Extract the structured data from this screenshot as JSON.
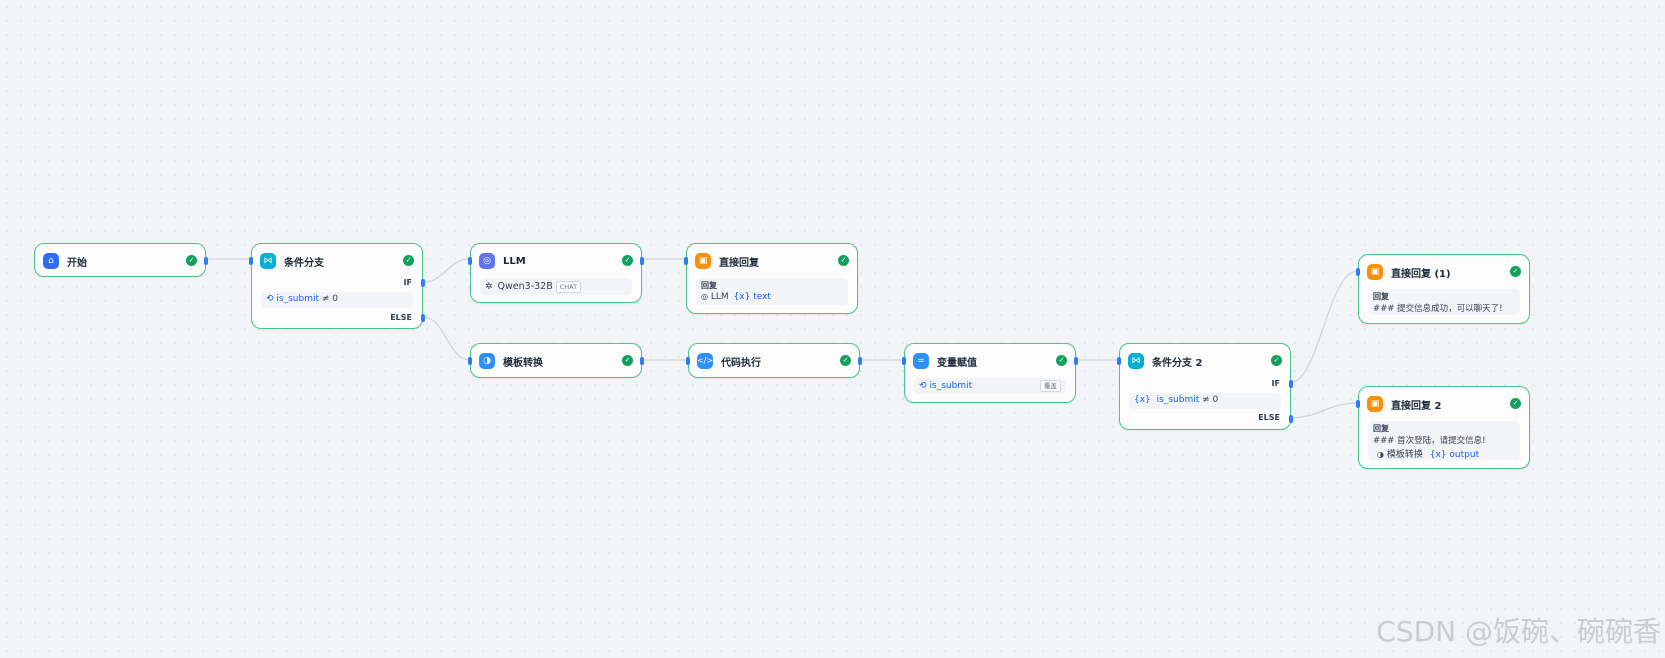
{
  "colors": {
    "border": "#47c78a",
    "handle": "#2e7cf6",
    "status": "#12a05c",
    "edge": "#d0d5dd"
  },
  "nodes": {
    "start": {
      "title": "开始",
      "icon": "home-icon",
      "color": "#2e6cf6"
    },
    "if1": {
      "title": "条件分支",
      "icon": "branch-icon",
      "color": "#06aed4",
      "condition_var": "is_submit",
      "operator": "≠ 0",
      "if_label": "IF",
      "else_label": "ELSE"
    },
    "llm": {
      "title": "LLM",
      "icon": "llm-icon",
      "color": "#6172f3",
      "model": "Qwen3-32B",
      "mode_tag": "CHAT"
    },
    "answer1": {
      "title": "直接回复",
      "icon": "answer-icon",
      "color": "#f79009",
      "reply_label": "回复",
      "source_node": "LLM",
      "source_var": "text"
    },
    "template": {
      "title": "模板转换",
      "icon": "template-icon",
      "color": "#2e90fa"
    },
    "code": {
      "title": "代码执行",
      "icon": "code-icon",
      "color": "#2e90fa"
    },
    "assign": {
      "title": "变量赋值",
      "icon": "assign-icon",
      "color": "#2e90fa",
      "var": "is_submit",
      "op_tag": "覆盖"
    },
    "if2": {
      "title": "条件分支 2",
      "icon": "branch-icon",
      "color": "#06aed4",
      "condition_var": "is_submit",
      "operator": "≠ 0",
      "if_label": "IF",
      "else_label": "ELSE"
    },
    "answer_a": {
      "title": "直接回复 (1)",
      "icon": "answer-icon",
      "color": "#f79009",
      "reply_label": "回复",
      "text": "### 提交信息成功，可以聊天了!"
    },
    "answer_b": {
      "title": "直接回复 2",
      "icon": "answer-icon",
      "color": "#f79009",
      "reply_label": "回复",
      "text": "### 首次登陆，请提交信息!",
      "source_node": "模板转换",
      "source_var": "output"
    }
  },
  "var_prefix": "{x}",
  "watermark": "CSDN @饭碗、碗碗香"
}
